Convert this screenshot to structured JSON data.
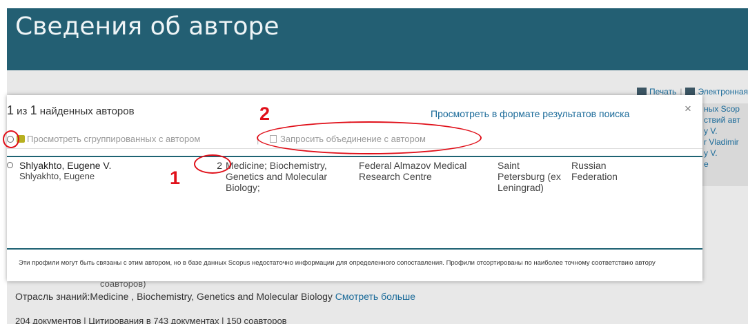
{
  "page": {
    "title": "Сведения об авторе",
    "actions": {
      "print": "Печать",
      "separator": "|",
      "email": "Электронная"
    },
    "side_snippets": [
      "ных Scop",
      "ствий авт",
      "y V.",
      "r Vladimir",
      "y V.",
      "e"
    ],
    "coauthors_fragment": "соавторов)",
    "subject_label": "Отрасль знаний:Medicine ,  Biochemistry, Genetics and Molecular Biology",
    "subject_more": "Смотреть больше",
    "footer_fragment": "204 документов  |  Цитирования в 743 документах  |  150 соавторов"
  },
  "modal": {
    "count_prefix": "1",
    "count_mid": " из ",
    "count_total": "1",
    "count_suffix": " найденных авторов",
    "view_link": "Просмотреть в формате результатов поиска",
    "close": "×",
    "toolbar": {
      "view_grouped": "Просмотреть сгруппированных с автором",
      "separator": "|",
      "request_merge": "Запросить объединение с автором"
    },
    "results": [
      {
        "name": "Shlyakhto, Eugene V.",
        "alt_name": "Shlyakhto, Eugene",
        "documents": "2",
        "subject": "Medicine; Biochemistry, Genetics and Molecular Biology;",
        "affiliation": "Federal Almazov Medical Research Centre",
        "city": "Saint Petersburg (ex Leningrad)",
        "country": "Russian Federation"
      }
    ],
    "note": "Эти профили могут быть связаны с этим автором, но в базе данных Scopus недостаточно информации для определенного сопоставления. Профили отсортированы по наиболее точному соответствию автору"
  },
  "annotations": {
    "label_1": "1",
    "label_2": "2",
    "color": "#e0101a"
  },
  "colors": {
    "header_bg": "#235f73",
    "link": "#1a6a99",
    "divider": "#1e6273"
  }
}
